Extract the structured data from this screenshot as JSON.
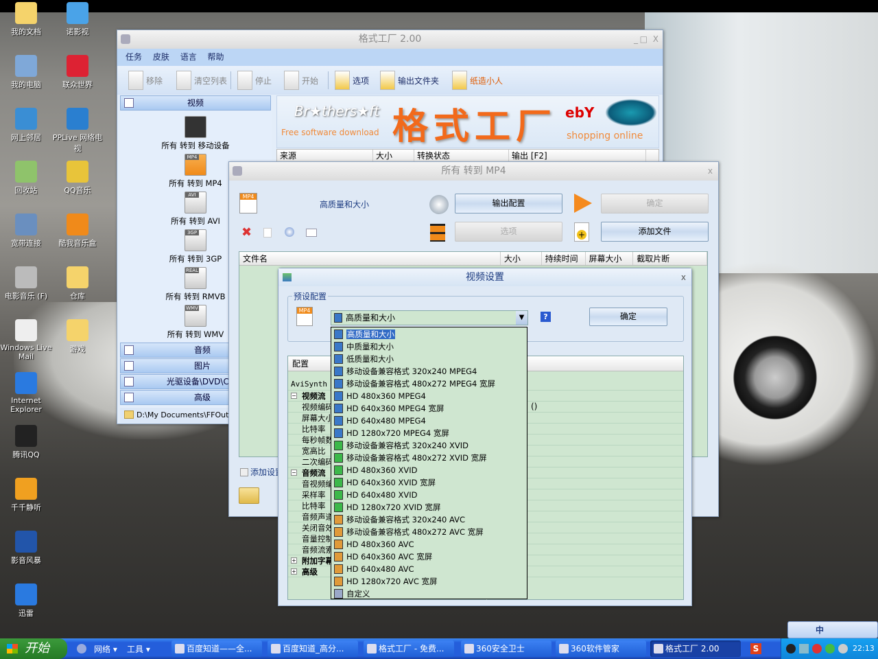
{
  "desktop": {
    "icons": [
      {
        "label": "我的文档",
        "color": "#f5d36b"
      },
      {
        "label": "诺影视",
        "color": "#4aa3e8"
      },
      {
        "label": "我的电脑",
        "color": "#7fa8d8"
      },
      {
        "label": "联众世界",
        "color": "#d23"
      },
      {
        "label": "网上邻居",
        "color": "#3a8ed4"
      },
      {
        "label": "PPLive 网络电视",
        "color": "#2a7fd0"
      },
      {
        "label": "回收站",
        "color": "#8fc36b"
      },
      {
        "label": "QQ音乐",
        "color": "#e8c43a"
      },
      {
        "label": "宽带连接",
        "color": "#6a8fbf"
      },
      {
        "label": "酷我音乐盒",
        "color": "#f08a1a"
      },
      {
        "label": "电影音乐 (F)",
        "color": "#bbb"
      },
      {
        "label": "仓库",
        "color": "#f5d36b"
      },
      {
        "label": "Windows Live Mail",
        "color": "#eee"
      },
      {
        "label": "游戏",
        "color": "#f5d36b"
      },
      {
        "label": "Internet Explorer",
        "color": "#2a7ae0"
      },
      {
        "label": "腾讯QQ",
        "color": "#222"
      },
      {
        "label": "千千静听",
        "color": "#f0a020"
      },
      {
        "label": "影音风暴",
        "color": "#2255aa"
      },
      {
        "label": "迅雷",
        "color": "#2a7ae0"
      }
    ]
  },
  "main_window": {
    "title": "格式工厂 2.00",
    "menu": [
      "任务",
      "皮肤",
      "语言",
      "帮助"
    ],
    "toolbar": [
      {
        "label": "移除",
        "enabled": false
      },
      {
        "label": "清空列表",
        "enabled": false
      },
      {
        "label": "停止",
        "enabled": false
      },
      {
        "label": "开始",
        "enabled": false
      },
      {
        "label": "选项",
        "enabled": true
      },
      {
        "label": "输出文件夹",
        "enabled": true
      },
      {
        "label": "纸造小人",
        "enabled": true,
        "color": "#e05a00"
      }
    ],
    "sidebar": {
      "video_header": "视频",
      "video_items": [
        "所有 转到 移动设备",
        "所有 转到 MP4",
        "所有 转到 AVI",
        "所有 转到 3GP",
        "所有 转到 RMVB",
        "所有 转到 WMV"
      ],
      "video_badges": [
        "",
        "MP4",
        "AVI",
        "3GP",
        "REAL",
        "WMV"
      ],
      "sections": [
        "音频",
        "图片",
        "光驱设备\\DVD\\CD\\",
        "高级"
      ],
      "output_path": "D:\\My Documents\\FFOutput"
    },
    "banner": {
      "brand": "Br★thers★ft",
      "brand_sub": "Free software download",
      "title": "格式工厂",
      "ebay": "ebY",
      "ebay_sub": "shopping online"
    },
    "table_headers": [
      "来源",
      "大小",
      "转换状态",
      "输出 [F2]"
    ]
  },
  "mp4_dialog": {
    "title": "所有 转到 MP4",
    "quality": "高质量和大小",
    "output_config_button": "输出配置",
    "ok_button": "确定",
    "options_button": "选项",
    "add_file_button": "添加文件",
    "table_headers": [
      "文件名",
      "大小",
      "持续时间",
      "屏幕大小",
      "截取片断"
    ],
    "add_settings_checkbox": "添加设置"
  },
  "video_settings": {
    "title": "视频设置",
    "preset_group": "预设配置",
    "preset_selected": "高质量和大小",
    "help": "?",
    "ok_button": "确定",
    "config_header": "配置",
    "tree": [
      {
        "label": "AviSynth",
        "type": "plain"
      },
      {
        "label": "视频流",
        "type": "group",
        "expanded": true
      },
      {
        "label": "视频编码",
        "type": "child",
        "value": "()"
      },
      {
        "label": "屏幕大小",
        "type": "child"
      },
      {
        "label": "比特率",
        "type": "child"
      },
      {
        "label": "每秒帧数",
        "type": "child"
      },
      {
        "label": "宽高比",
        "type": "child"
      },
      {
        "label": "二次编码",
        "type": "child"
      },
      {
        "label": "音频流",
        "type": "group",
        "expanded": true
      },
      {
        "label": "音视频编码",
        "type": "child"
      },
      {
        "label": "采样率",
        "type": "child"
      },
      {
        "label": "比特率",
        "type": "child"
      },
      {
        "label": "音频声道",
        "type": "child"
      },
      {
        "label": "关闭音效",
        "type": "child"
      },
      {
        "label": "音量控制",
        "type": "child"
      },
      {
        "label": "音频流索引",
        "type": "child"
      },
      {
        "label": "附加字幕",
        "type": "group",
        "expanded": false
      },
      {
        "label": "高级",
        "type": "group",
        "expanded": false
      }
    ],
    "dropdown_options": [
      {
        "label": "高质量和大小",
        "color": "#3a78c8",
        "selected": true
      },
      {
        "label": "中质量和大小",
        "color": "#3a78c8"
      },
      {
        "label": "低质量和大小",
        "color": "#3a78c8"
      },
      {
        "label": "移动设备兼容格式 320x240 MPEG4",
        "color": "#3a78c8"
      },
      {
        "label": "移动设备兼容格式 480x272 MPEG4 宽屏",
        "color": "#3a78c8"
      },
      {
        "label": "HD 480x360 MPEG4",
        "color": "#3a78c8"
      },
      {
        "label": "HD 640x360 MPEG4 宽屏",
        "color": "#3a78c8"
      },
      {
        "label": "HD 640x480 MPEG4",
        "color": "#3a78c8"
      },
      {
        "label": "HD 1280x720 MPEG4 宽屏",
        "color": "#3a78c8"
      },
      {
        "label": "移动设备兼容格式 320x240 XVID",
        "color": "#3cb84a"
      },
      {
        "label": "移动设备兼容格式 480x272 XVID 宽屏",
        "color": "#3cb84a"
      },
      {
        "label": "HD 480x360 XVID",
        "color": "#3cb84a"
      },
      {
        "label": "HD 640x360 XVID 宽屏",
        "color": "#3cb84a"
      },
      {
        "label": "HD 640x480 XVID",
        "color": "#3cb84a"
      },
      {
        "label": "HD 1280x720 XVID 宽屏",
        "color": "#3cb84a"
      },
      {
        "label": "移动设备兼容格式 320x240 AVC",
        "color": "#e09a3a"
      },
      {
        "label": "移动设备兼容格式 480x272 AVC 宽屏",
        "color": "#e09a3a"
      },
      {
        "label": "HD 480x360 AVC",
        "color": "#e09a3a"
      },
      {
        "label": "HD 640x360 AVC 宽屏",
        "color": "#e09a3a"
      },
      {
        "label": "HD 640x480 AVC",
        "color": "#e09a3a"
      },
      {
        "label": "HD 1280x720 AVC 宽屏",
        "color": "#e09a3a"
      },
      {
        "label": "自定义",
        "color": "#9aa8c8"
      }
    ]
  },
  "taskbar": {
    "start": "开始",
    "quicklaunch": [
      "网络 ▾",
      "工具 ▾"
    ],
    "tasks": [
      {
        "label": "百度知道——全...",
        "active": false
      },
      {
        "label": "百度知道_高分...",
        "active": false
      },
      {
        "label": "格式工厂 - 免费...",
        "active": false
      },
      {
        "label": "360安全卫士",
        "active": false
      },
      {
        "label": "360软件管家",
        "active": false
      },
      {
        "label": "格式工厂 2.00",
        "active": true
      }
    ],
    "clock": "22:13"
  },
  "language_bar": {
    "label": "中"
  }
}
